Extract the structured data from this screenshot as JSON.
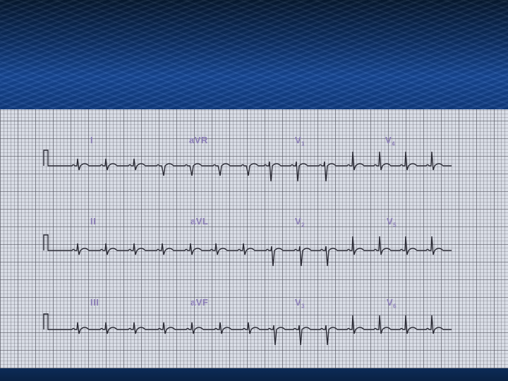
{
  "colors": {
    "header_dark": "#061a33",
    "header_blue": "#174a9a",
    "grid_background": "#d9dde6",
    "trace": "#2b2b35",
    "label": "#8d7fb8"
  },
  "ecg": {
    "rows": [
      {
        "leads": [
          {
            "name": "I",
            "sub": ""
          },
          {
            "name": "aVR",
            "sub": ""
          },
          {
            "name": "V",
            "sub": "1"
          },
          {
            "name": "V",
            "sub": "4"
          }
        ]
      },
      {
        "leads": [
          {
            "name": "II",
            "sub": ""
          },
          {
            "name": "aVL",
            "sub": ""
          },
          {
            "name": "V",
            "sub": "2"
          },
          {
            "name": "V",
            "sub": "5"
          }
        ]
      },
      {
        "leads": [
          {
            "name": "III",
            "sub": ""
          },
          {
            "name": "aVF",
            "sub": ""
          },
          {
            "name": "V",
            "sub": "3"
          },
          {
            "name": "V",
            "sub": "6"
          }
        ]
      }
    ]
  }
}
